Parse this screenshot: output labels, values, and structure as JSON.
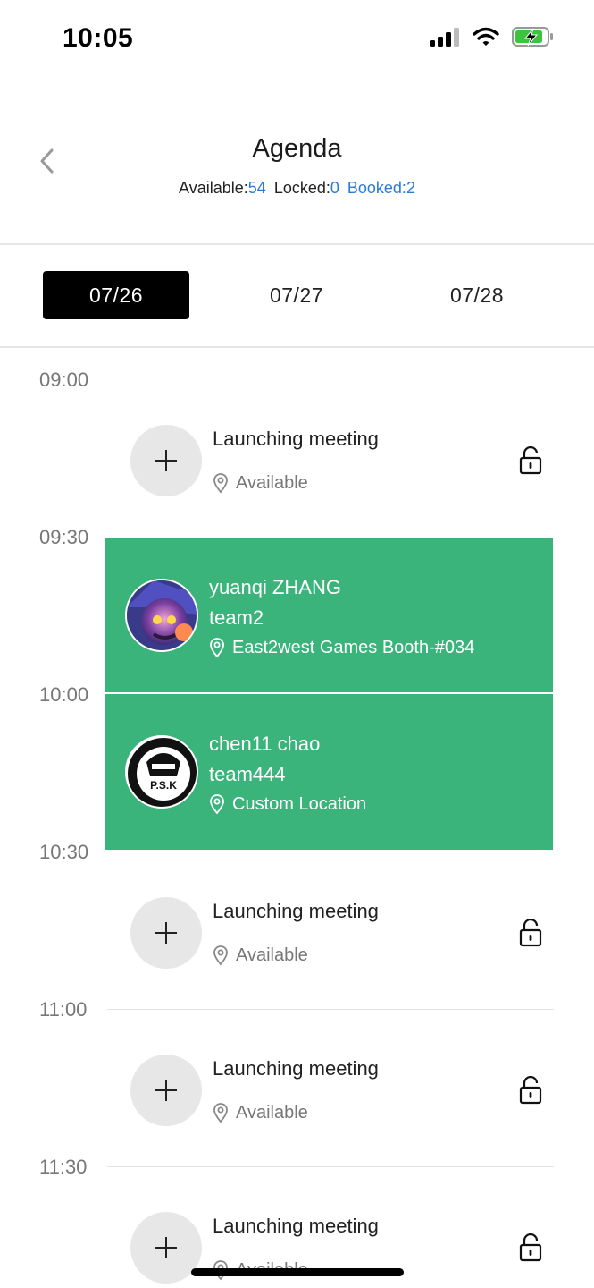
{
  "status_bar": {
    "time": "10:05"
  },
  "header": {
    "title": "Agenda",
    "available_label": "Available:",
    "available_count": "54",
    "locked_label": "Locked:",
    "locked_count": "0",
    "booked_label": "Booked:",
    "booked_count": "2"
  },
  "date_tabs": [
    {
      "label": "07/26",
      "active": true
    },
    {
      "label": "07/27",
      "active": false
    },
    {
      "label": "07/28",
      "active": false
    }
  ],
  "time_labels": [
    "09:00",
    "09:30",
    "10:00",
    "10:30",
    "11:00",
    "11:30"
  ],
  "slots": [
    {
      "time": "09:00",
      "title": "Launching meeting",
      "status": "Available"
    },
    {
      "time": "10:30",
      "title": "Launching meeting",
      "status": "Available"
    },
    {
      "time": "11:00",
      "title": "Launching meeting",
      "status": "Available"
    },
    {
      "time": "11:30",
      "title": "Launching meeting",
      "status": "Available"
    }
  ],
  "bookings": [
    {
      "time": "09:30",
      "name": "yuanqi ZHANG",
      "team": "team2",
      "location": "East2west Games Booth-#034"
    },
    {
      "time": "10:00",
      "name": "chen11 chao",
      "team": "team444",
      "location": "Custom Location",
      "avatar_text": "P.S.K"
    }
  ],
  "colors": {
    "booked_bg": "#3bb47c",
    "accent_blue": "#2a7bd8",
    "active_tab": "#000000"
  },
  "icons": [
    "back-chevron-icon",
    "plus-icon",
    "location-pin-icon",
    "unlock-icon",
    "signal-icon",
    "wifi-icon",
    "battery-charging-icon"
  ]
}
